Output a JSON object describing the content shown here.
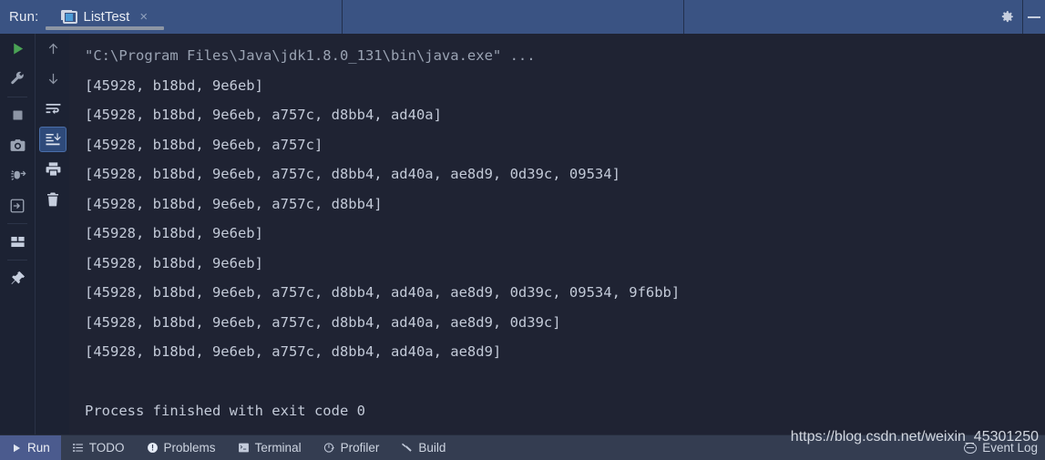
{
  "window": {
    "run_label": "Run:",
    "tab": {
      "title": "ListTest",
      "close": "×",
      "icon": "console-window-icon"
    },
    "settings_icon": "gear-icon",
    "minimize_icon": "minimize-icon"
  },
  "left_toolbar": {
    "column1": [
      {
        "name": "rerun-button",
        "icon": "play-icon",
        "selected": false
      },
      {
        "name": "run-configurations-button",
        "icon": "wrench-icon",
        "selected": false
      },
      {
        "name": "stop-button",
        "icon": "stop-square-icon",
        "selected": false
      },
      {
        "name": "screenshot-button",
        "icon": "camera-icon",
        "selected": false
      },
      {
        "name": "thread-dump-button",
        "icon": "bug-arrow-icon",
        "selected": false
      },
      {
        "name": "export-button",
        "icon": "import-arrow-icon",
        "selected": false
      },
      {
        "name": "layout-button",
        "icon": "layout-icon",
        "selected": false
      },
      {
        "name": "pin-tab-button",
        "icon": "pin-icon",
        "selected": false
      }
    ],
    "column2": [
      {
        "name": "previous-occurrence-button",
        "icon": "arrow-up-icon",
        "selected": false
      },
      {
        "name": "next-occurrence-button",
        "icon": "arrow-down-icon",
        "selected": false
      },
      {
        "name": "soft-wrap-button",
        "icon": "soft-wrap-icon",
        "selected": false
      },
      {
        "name": "scroll-to-end-button",
        "icon": "scroll-to-end-icon",
        "selected": true
      },
      {
        "name": "print-button",
        "icon": "printer-icon",
        "selected": false
      },
      {
        "name": "clear-all-button",
        "icon": "trash-icon",
        "selected": false
      }
    ]
  },
  "console": {
    "lines": [
      {
        "text": "\"C:\\Program Files\\Java\\jdk1.8.0_131\\bin\\java.exe\" ...",
        "kind": "cmd"
      },
      {
        "text": "[45928, b18bd, 9e6eb]",
        "kind": "out"
      },
      {
        "text": "[45928, b18bd, 9e6eb, a757c, d8bb4, ad40a]",
        "kind": "out"
      },
      {
        "text": "[45928, b18bd, 9e6eb, a757c]",
        "kind": "out"
      },
      {
        "text": "[45928, b18bd, 9e6eb, a757c, d8bb4, ad40a, ae8d9, 0d39c, 09534]",
        "kind": "out"
      },
      {
        "text": "[45928, b18bd, 9e6eb, a757c, d8bb4]",
        "kind": "out"
      },
      {
        "text": "[45928, b18bd, 9e6eb]",
        "kind": "out"
      },
      {
        "text": "[45928, b18bd, 9e6eb]",
        "kind": "out"
      },
      {
        "text": "[45928, b18bd, 9e6eb, a757c, d8bb4, ad40a, ae8d9, 0d39c, 09534, 9f6bb]",
        "kind": "out"
      },
      {
        "text": "[45928, b18bd, 9e6eb, a757c, d8bb4, ad40a, ae8d9, 0d39c]",
        "kind": "out"
      },
      {
        "text": "[45928, b18bd, 9e6eb, a757c, d8bb4, ad40a, ae8d9]",
        "kind": "out"
      },
      {
        "text": " ",
        "kind": "blank"
      },
      {
        "text": "Process finished with exit code 0",
        "kind": "out"
      }
    ]
  },
  "status_bar": {
    "items": [
      {
        "label": "Run",
        "icon": "play-icon",
        "active": true
      },
      {
        "label": "TODO",
        "icon": "list-icon",
        "active": false
      },
      {
        "label": "Problems",
        "icon": "exclamation-circle-icon",
        "active": false
      },
      {
        "label": "Terminal",
        "icon": "terminal-icon",
        "active": false
      },
      {
        "label": "Profiler",
        "icon": "profiler-icon",
        "active": false
      },
      {
        "label": "Build",
        "icon": "hammer-icon",
        "active": false
      }
    ],
    "event_log": {
      "label": "Event Log",
      "icon": "event-log-icon"
    }
  },
  "watermark": {
    "text": "https://blog.csdn.net/weixin_45301250"
  },
  "colors": {
    "header_bg": "#3a5383",
    "console_bg": "#1f2333",
    "toolbar_bg": "#1c2233",
    "status_bg": "#343d51",
    "status_active": "#4b5b8e",
    "console_text": "#c3cad8",
    "command_text": "#9aa3b3",
    "accent_green": "#4aa355",
    "selected_icon_bg": "#2e4a7a"
  }
}
